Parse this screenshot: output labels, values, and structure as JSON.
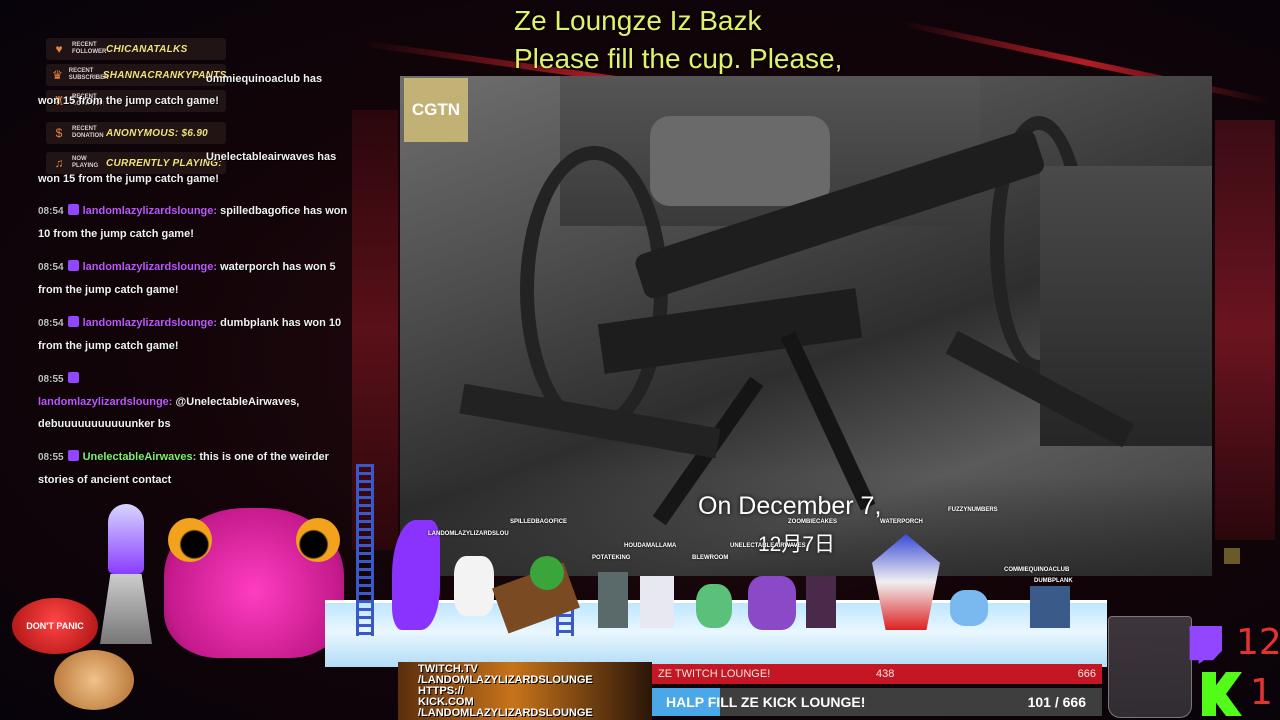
{
  "header": {
    "line1": "Ze Loungze Iz Bazk",
    "line2": "Please fill the cup. Please,"
  },
  "video": {
    "logo": "CGTN",
    "subtitle": "On December 7,",
    "subtitle_cn": "12月7日"
  },
  "notifications": [
    {
      "kind": "RECENT FOLLOWER",
      "who": "CHICANATALKS",
      "icon": "heart-icon"
    },
    {
      "kind": "RECENT SUBSCRIBER",
      "who": "SHANNACRANKYPANTS",
      "icon": "crown-icon"
    },
    {
      "kind": "RECENT DONATION",
      "who": "",
      "icon": "trophy-icon"
    },
    {
      "kind": "RECENT DONATION",
      "who": "ANONYMOUS: $6.90",
      "icon": "money-icon"
    },
    {
      "kind": "NOW PLAYING",
      "who": "CURRENTLY PLAYING:",
      "icon": "music-icon"
    }
  ],
  "chat": [
    {
      "time": "",
      "user": "",
      "text": "ommiequinoaclub has"
    },
    {
      "time": "",
      "user": "",
      "text": "won 15 from the jump catch game!"
    },
    {
      "time": "",
      "user": "",
      "text": "Unelectableairwaves has"
    },
    {
      "time": "",
      "user": "",
      "text": "won 15 from the jump catch game!"
    },
    {
      "time": "08:54",
      "user": "landomlazylizardslounge:",
      "text": "spilledbagofice has won 10 from the jump catch game!"
    },
    {
      "time": "08:54",
      "user": "landomlazylizardslounge:",
      "text": "waterporch has won 5 from the jump catch game!"
    },
    {
      "time": "08:54",
      "user": "landomlazylizardslounge:",
      "text": "dumbplank has won 10 from the jump catch game!"
    },
    {
      "time": "08:55",
      "user": "landomlazylizardslounge:",
      "text": "@UnelectableAirwaves, debuuuuuuuuuuunker bs"
    },
    {
      "time": "08:55",
      "user": "UnelectableAirwaves:",
      "text": "this is one of the weirder stories of ancient contact"
    }
  ],
  "players": [
    {
      "name": "LANDOMLAZYLIZARDSLOU"
    },
    {
      "name": "SPILLEDBAGOFICE"
    },
    {
      "name": "POTATEKING"
    },
    {
      "name": "HOUDAMALLAMA"
    },
    {
      "name": "BLEWROOM"
    },
    {
      "name": "UNELECTABLEAIRWAVES"
    },
    {
      "name": "ZOOMBIECAKES"
    },
    {
      "name": "WATERPORCH"
    },
    {
      "name": "FUZZYNUMBERS"
    },
    {
      "name": "COMMIEQUINOACLUB"
    },
    {
      "name": "DUMBPLANK"
    }
  ],
  "links": {
    "line1": "TWITCH.TV",
    "line2": "/LANDOMLAZYLIZARDSLOUNGE",
    "line3": "HTTPS://",
    "line4": "KICK.COM",
    "line5": "/LANDOMLAZYLIZARDSLOUNGE"
  },
  "goals": {
    "twitch_label": "ZE TWITCH LOUNGE!",
    "twitch_current": "438",
    "twitch_target": "666",
    "kick_label": "HALP FILL ZE KICK LOUNGE!",
    "kick_progress": "101 / 666",
    "kick_fraction": 0.152
  },
  "counters": {
    "twitch": "12",
    "kick": "1"
  },
  "button": {
    "label": "DON'T PANIC"
  },
  "colors": {
    "header": "#dff36a",
    "twitch": "#9146ff",
    "kick": "#53fc18",
    "counter": "#e23232"
  }
}
